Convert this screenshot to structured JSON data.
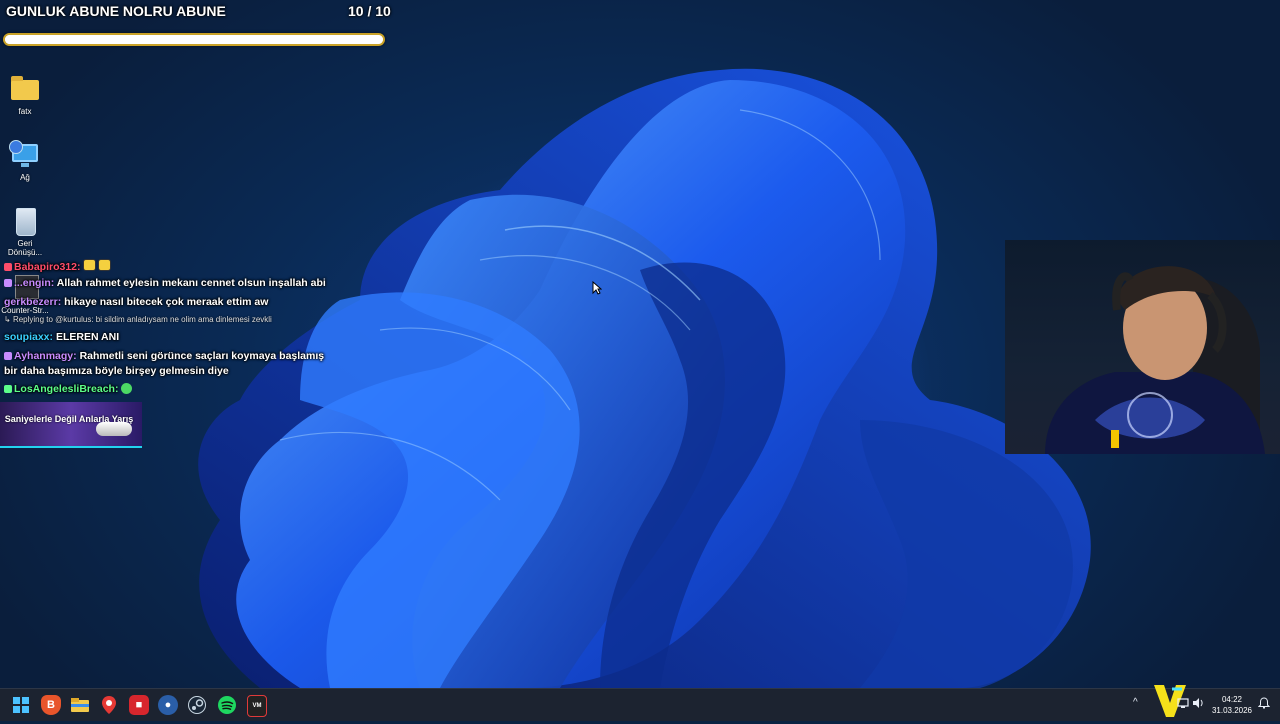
{
  "overlay": {
    "goal_title": "GUNLUK ABUNE NOLRU ABUNE",
    "goal_count": "10 / 10",
    "goal_progress": 1.0
  },
  "desktop_icons": [
    {
      "label": "fatx",
      "icon": "folder-icon"
    },
    {
      "label": "Ağ",
      "icon": "network-icon"
    },
    {
      "label": "Geri Dönüşü...",
      "icon": "recycle-bin-icon"
    },
    {
      "label": "Counter-Str...",
      "icon": "counter-strike-icon"
    }
  ],
  "chat": {
    "messages": [
      {
        "user": "Babapiro312:",
        "text": "",
        "user_color": "#ff4d6a"
      },
      {
        "user": "...engin:",
        "text": "Allah rahmet eylesin mekanı cennet olsun inşallah abi",
        "user_color": "#c88cff"
      },
      {
        "user": "gerkbezerr:",
        "text": "hikaye nasıl bitecek çok meraak ettim aw",
        "user_color": "#c88cff"
      },
      {
        "user": "soupiaxx:",
        "text": "ELEREN ANI",
        "user_color": "#39d0ff"
      },
      {
        "user": "Ayhanmagy:",
        "text": "Rahmetli seni görünce saçları koymaya başlamış",
        "user_color": "#c88cff"
      },
      {
        "user": "LosAngelesliBreach:",
        "text": "",
        "user_color": "#5cff8a"
      }
    ],
    "continuation": "bir daha başımıza böyle birşey gelmesin diye",
    "reply_context": "Replying to @kurtulus: bi sildim anladıysam ne olim ama dinlemesi zevkli",
    "ad_text": "Saniyelerle Değil Anlarla Yarış"
  },
  "taskbar": {
    "apps": [
      "start-icon",
      "brave-icon",
      "file-explorer-icon",
      "maps-icon",
      "red-app-icon",
      "blue-app-icon",
      "steam-icon",
      "spotify-icon",
      "voicemeeter-icon"
    ],
    "tray_chevron": "^",
    "time": "04:22",
    "date": "31.03.2026"
  },
  "colors": {
    "taskbar_bg": "#1c2330",
    "goal_border": "#c9a227",
    "wallpaper_blue": "#1f6bff"
  }
}
